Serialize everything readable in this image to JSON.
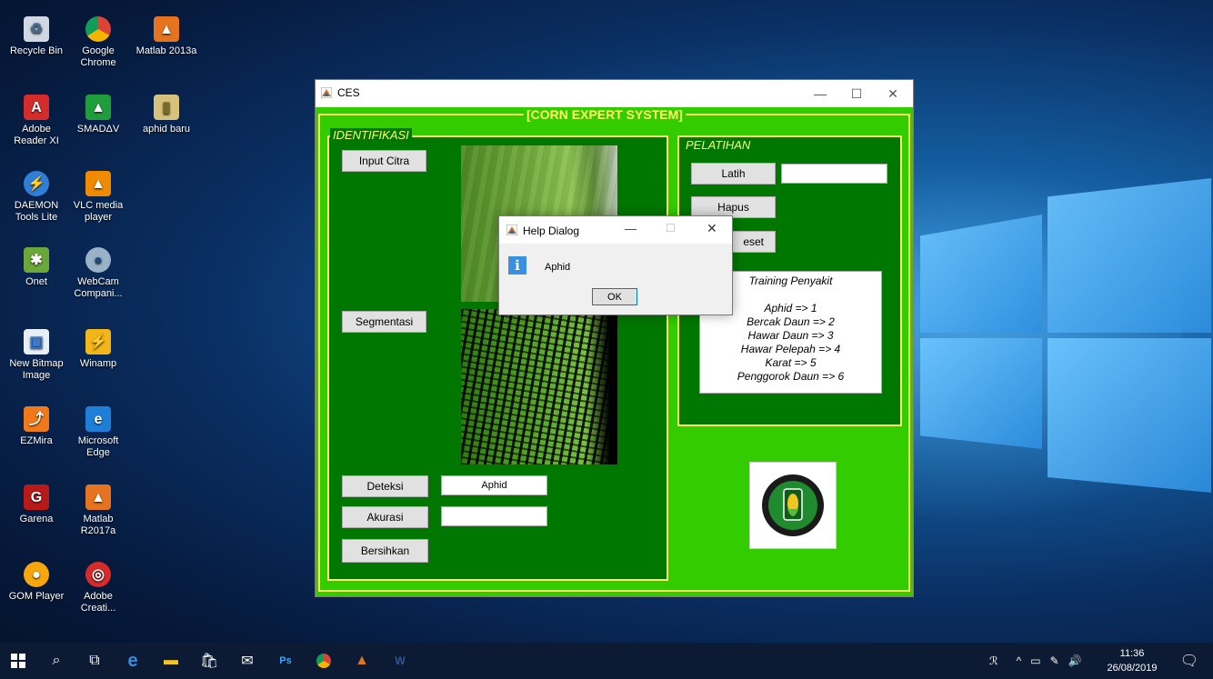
{
  "desktop": {
    "icons": [
      {
        "label": "Recycle Bin",
        "icon": "recycle-bin-icon"
      },
      {
        "label": "Google Chrome",
        "icon": "chrome-icon"
      },
      {
        "label": "Matlab 2013a",
        "icon": "matlab-icon"
      },
      {
        "label": "Adobe Reader XI",
        "icon": "adobe-reader-icon"
      },
      {
        "label": "SMADΔV",
        "icon": "smadav-icon"
      },
      {
        "label": "aphid baru",
        "icon": "folder-icon"
      },
      {
        "label": "DAEMON Tools Lite",
        "icon": "daemon-tools-icon"
      },
      {
        "label": "VLC media player",
        "icon": "vlc-icon"
      },
      {
        "label": "Onet",
        "icon": "onet-icon"
      },
      {
        "label": "WebCam Compani...",
        "icon": "webcam-icon"
      },
      {
        "label": "New Bitmap Image",
        "icon": "bitmap-icon"
      },
      {
        "label": "Winamp",
        "icon": "winamp-icon"
      },
      {
        "label": "EZMira",
        "icon": "ezmira-icon"
      },
      {
        "label": "Microsoft Edge",
        "icon": "edge-icon"
      },
      {
        "label": "Garena",
        "icon": "garena-icon"
      },
      {
        "label": "Matlab R2017a",
        "icon": "matlab-icon"
      },
      {
        "label": "GOM Player",
        "icon": "gom-player-icon"
      },
      {
        "label": "Adobe Creati...",
        "icon": "adobe-creative-icon"
      }
    ]
  },
  "window": {
    "title": "CES",
    "main_title": "[CORN EXPERT SYSTEM]",
    "identifikasi": {
      "title": "IDENTIFIKASI",
      "input_citra": "Input Citra",
      "segmentasi": "Segmentasi",
      "deteksi": "Deteksi",
      "deteksi_result": "Aphid",
      "akurasi": "Akurasi",
      "akurasi_result": "",
      "bersihkan": "Bersihkan"
    },
    "pelatihan": {
      "title": "PELATIHAN",
      "latih": "Latih",
      "latih_field": "",
      "hapus": "Hapus",
      "reset": "eset",
      "training_lines": [
        "Training Penyakit",
        "",
        "Aphid => 1",
        "Bercak Daun => 2",
        "Hawar Daun => 3",
        "Hawar Pelepah => 4",
        "Karat => 5",
        "Penggorok Daun => 6"
      ]
    }
  },
  "dialog": {
    "title": "Help Dialog",
    "message": "Aphid",
    "ok": "OK"
  },
  "taskbar": {
    "time": "11:36",
    "date": "26/08/2019",
    "apps": [
      "start-icon",
      "search-icon",
      "task-view-icon",
      "edge-icon",
      "file-explorer-icon",
      "store-icon",
      "mail-icon",
      "photoshop-icon",
      "chrome-icon",
      "matlab-icon",
      "word-icon"
    ]
  },
  "colors": {
    "panel_green": "#33cc00",
    "dark_green": "#007700",
    "frame_yellow": "#ffff66"
  }
}
